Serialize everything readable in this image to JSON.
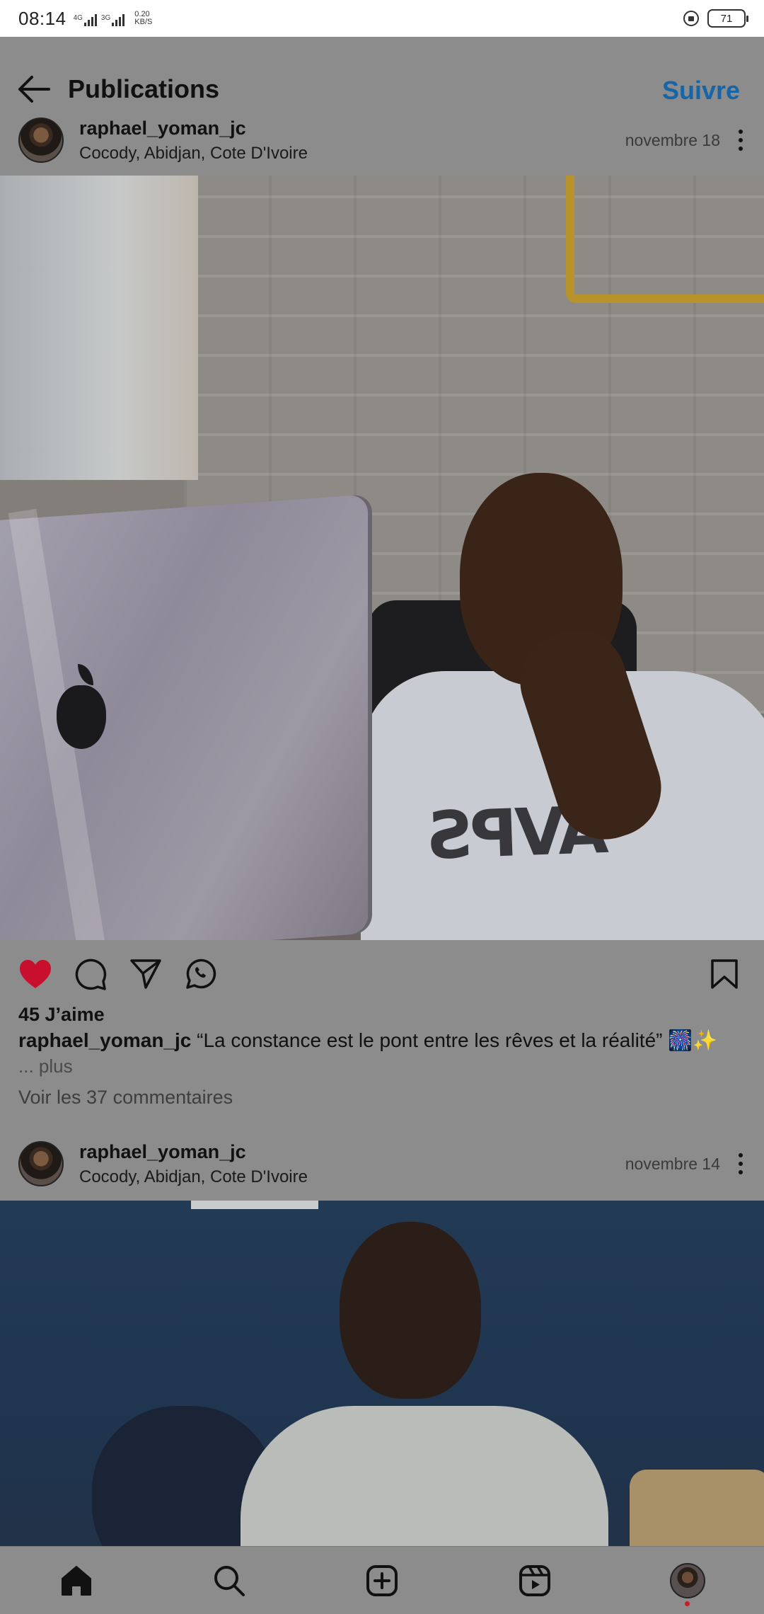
{
  "status_bar": {
    "time": "08:14",
    "network_1": "4G",
    "network_2": "3G",
    "speed_value": "0.20",
    "speed_unit": "KB/S",
    "battery": "71"
  },
  "header": {
    "title": "Publications",
    "follow_label": "Suivre",
    "follow_color": "#1565a8"
  },
  "posts": [
    {
      "username": "raphael_yoman_jc",
      "location": "Cocody, Abidjan, Cote D'Ivoire",
      "date": "novembre 18",
      "likes": "45 J’aime",
      "caption_user": "raphael_yoman_jc",
      "caption_text": "“La constance est le pont entre les rêves et la réalité” 🎆✨",
      "more_label": "... plus",
      "comments_label": "Voir les 37 commentaires",
      "liked": true,
      "like_color": "#c8102e"
    },
    {
      "username": "raphael_yoman_jc",
      "location": "Cocody, Abidjan, Cote D'Ivoire",
      "date": "novembre 14"
    }
  ],
  "icons": {
    "back": "arrow-left-icon",
    "more": "more-vertical-icon",
    "like": "heart-icon",
    "comment": "comment-icon",
    "share": "send-icon",
    "whatsapp": "whatsapp-icon",
    "save": "bookmark-icon",
    "nav": [
      "home-icon",
      "search-icon",
      "add-post-icon",
      "reels-icon",
      "profile-avatar"
    ]
  },
  "photo1_print": "AVPS"
}
